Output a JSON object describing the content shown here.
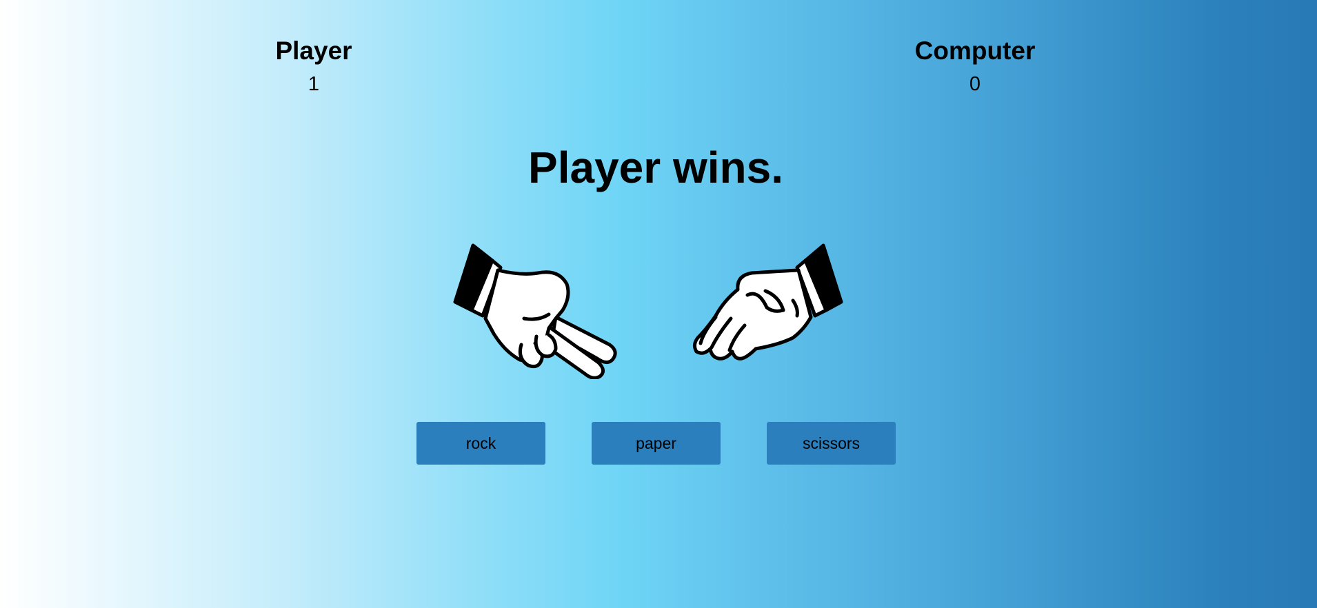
{
  "scoreboard": {
    "player": {
      "label": "Player",
      "score": "1"
    },
    "computer": {
      "label": "Computer",
      "score": "0"
    }
  },
  "result": "Player wins.",
  "hands": {
    "player": {
      "icon": "scissors-hand-icon"
    },
    "computer": {
      "icon": "paper-hand-icon"
    }
  },
  "choices": [
    {
      "label": "rock"
    },
    {
      "label": "paper"
    },
    {
      "label": "scissors"
    }
  ],
  "colors": {
    "button": "#2b7fbc",
    "background_left": "#ffffff",
    "background_center": "#6fd5f6",
    "background_right": "#2879b5"
  }
}
